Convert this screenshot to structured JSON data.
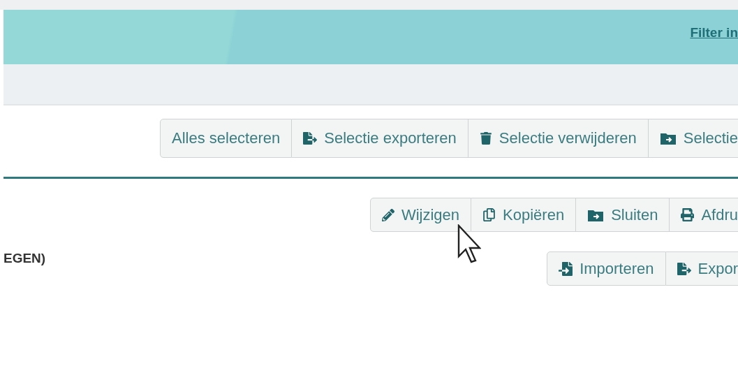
{
  "header": {
    "link": "Filter in"
  },
  "selection_toolbar": [
    {
      "kind": "plain",
      "label": "Alles selecteren"
    },
    {
      "kind": "export",
      "label": "Selectie exporteren"
    },
    {
      "kind": "delete",
      "label": "Selectie verwijderen"
    },
    {
      "kind": "close",
      "label": "Selectie"
    }
  ],
  "record_toolbar": [
    {
      "kind": "edit",
      "label": "Wijzigen"
    },
    {
      "kind": "copy",
      "label": "Kopiëren"
    },
    {
      "kind": "close",
      "label": "Sluiten"
    },
    {
      "kind": "print",
      "label": "Afdru"
    }
  ],
  "section_title": "EGEN)",
  "file_toolbar": [
    {
      "kind": "import",
      "label": "Importeren"
    },
    {
      "kind": "export",
      "label": "Expor"
    }
  ]
}
